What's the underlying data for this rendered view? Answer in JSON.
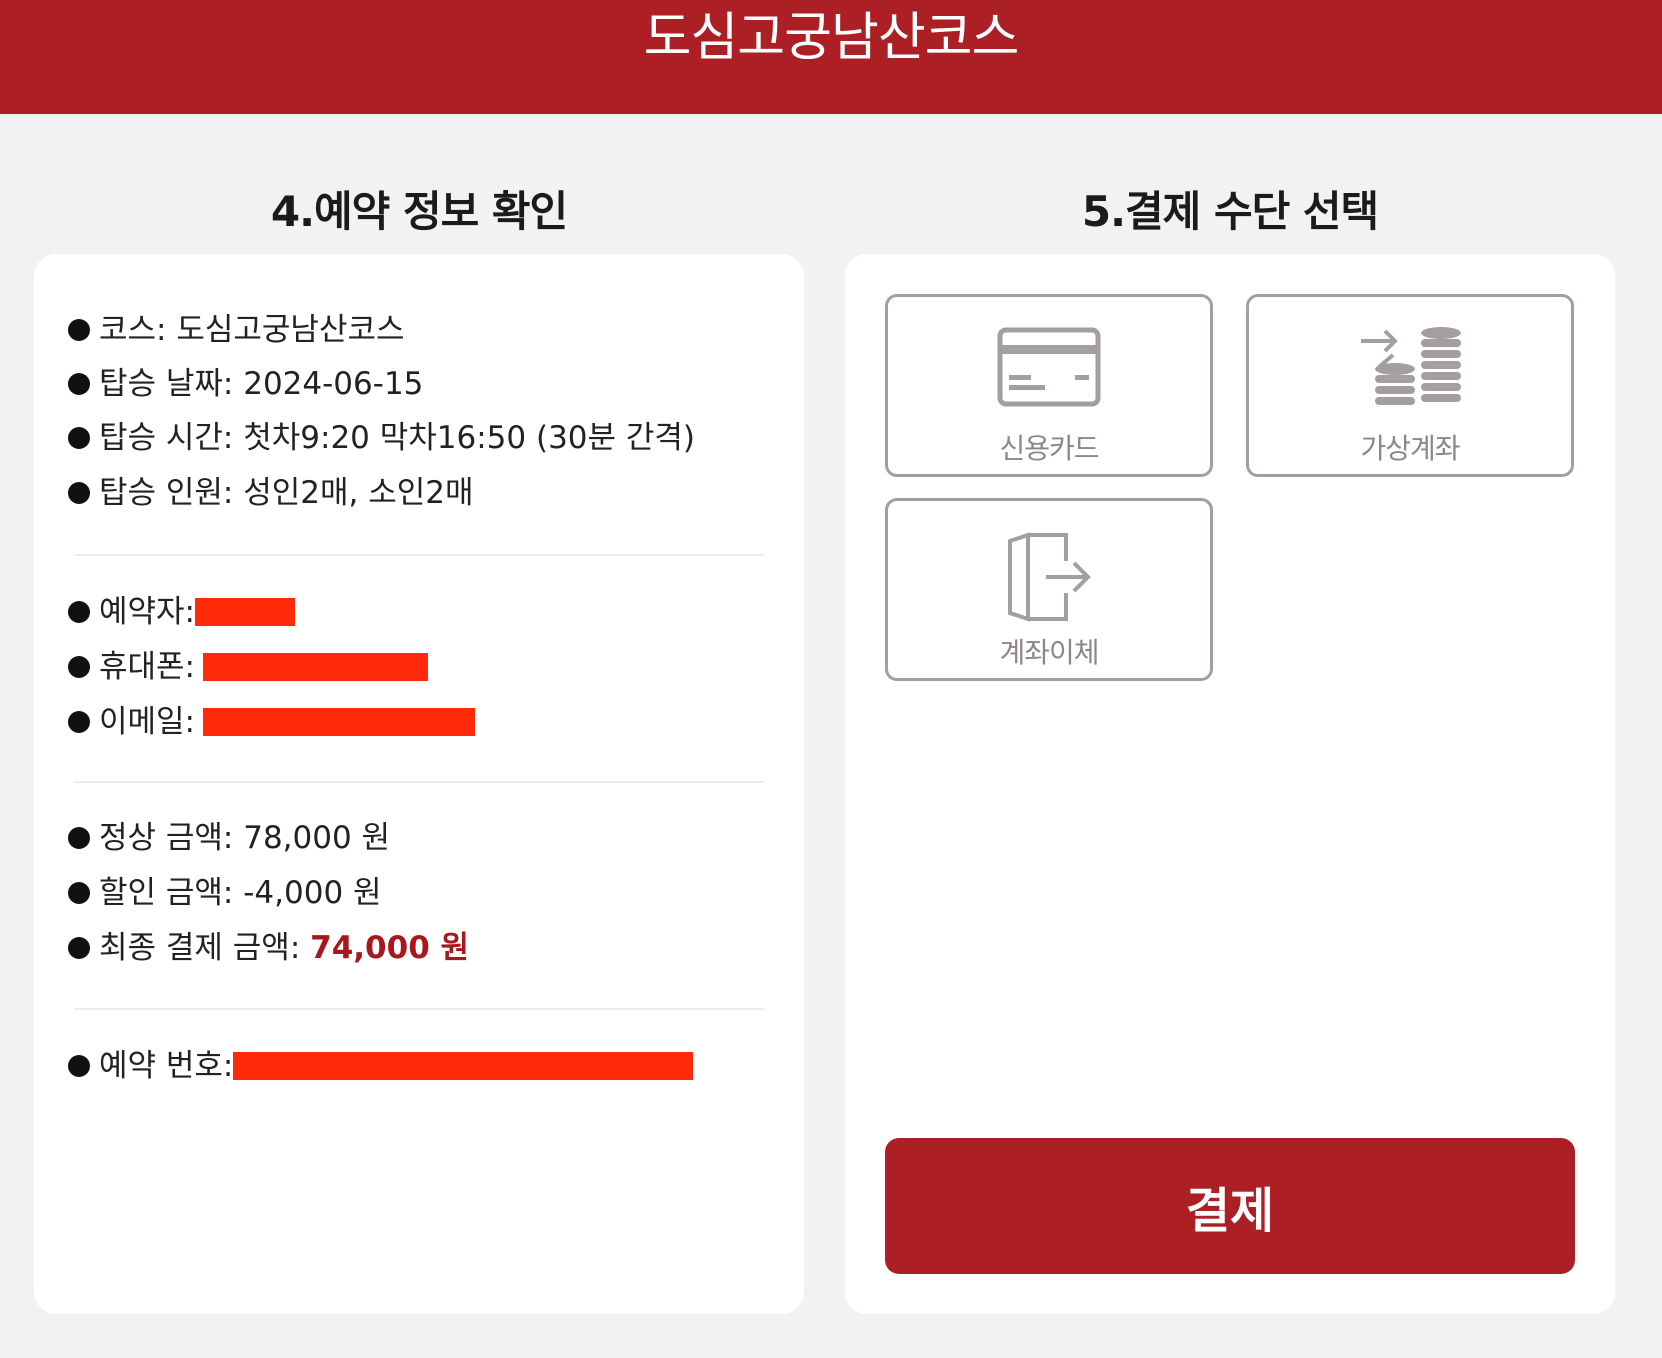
{
  "header": {
    "title": "도심고궁남산코스"
  },
  "reservation_info": {
    "section_title": "4.예약 정보 확인",
    "trip": {
      "course": "코스: 도심고궁남산코스",
      "date": "탑승 날짜: 2024-06-15",
      "time": "탑승 시간: 첫차9:20 막차16:50 (30분 간격)",
      "people": "탑승 인원: 성인2매, 소인2매"
    },
    "customer": {
      "name_label": "예약자:",
      "phone_label": "휴대폰:",
      "email_label": "이메일:"
    },
    "price": {
      "regular": "정상 금액: 78,000 원",
      "discount": "할인 금액: -4,000 원",
      "final_label": "최종 결제 금액: ",
      "final_value": "74,000 원"
    },
    "booking": {
      "number_label": "예약 번호:"
    }
  },
  "payment": {
    "section_title": "5.결제 수단 선택",
    "options": [
      {
        "label": "신용카드",
        "icon": "credit-card-icon"
      },
      {
        "label": "가상계좌",
        "icon": "coins-transfer-icon"
      },
      {
        "label": "계좌이체",
        "icon": "door-exit-icon"
      }
    ],
    "submit_label": "결제"
  },
  "colors": {
    "brand": "#ac1f24",
    "redaction": "#ff2a0a",
    "icon_gray": "#a59e9e"
  }
}
